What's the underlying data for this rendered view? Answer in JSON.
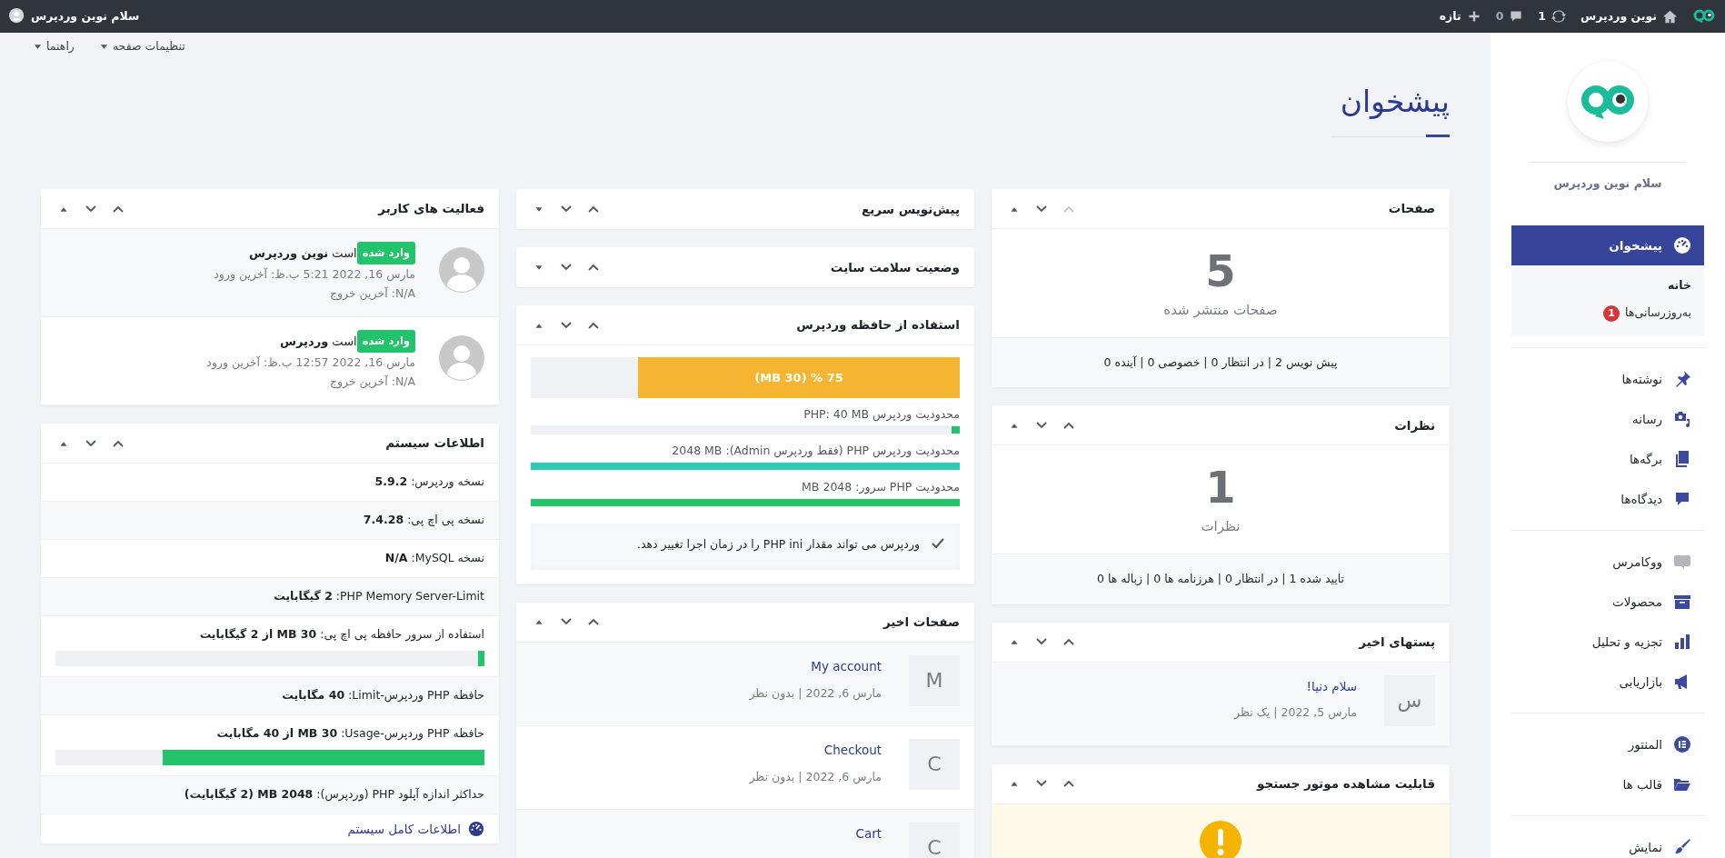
{
  "admin_bar": {
    "site_name": "نوین وردپرس",
    "updates": "1",
    "comments": "0",
    "new_label": "تازه",
    "greeting": "سلام نوین وردپرس"
  },
  "screen_links": [
    {
      "label": "تنظیمات صفحه"
    },
    {
      "label": "راهنما"
    }
  ],
  "page_title": "پیشخوان",
  "sidebar": {
    "greeting": "سلام نوین وردپرس",
    "groups": [
      {
        "items": [
          {
            "label": "پیشخوان",
            "selected": true,
            "children": [
              {
                "label": "خانه",
                "selected": true
              },
              {
                "label": "به‌روزرسانی‌ها",
                "selected": false,
                "badge": "1"
              }
            ]
          }
        ]
      },
      {
        "items": [
          {
            "label": "نوشته‌ها",
            "selected": false
          },
          {
            "label": "رسانه",
            "selected": false
          },
          {
            "label": "برگه‌ها",
            "selected": false
          },
          {
            "label": "دیدگاه‌ها",
            "selected": false
          }
        ]
      },
      {
        "items": [
          {
            "label": "ووکامرس",
            "selected": false
          },
          {
            "label": "محصولات",
            "selected": false
          },
          {
            "label": "تجزیه و تحلیل",
            "selected": false
          },
          {
            "label": "بازاریابی",
            "selected": false
          }
        ]
      },
      {
        "items": [
          {
            "label": "المنتور",
            "selected": false
          },
          {
            "label": "قالب ها",
            "selected": false
          }
        ]
      },
      {
        "items": [
          {
            "label": "نمایش",
            "selected": false
          }
        ]
      }
    ]
  },
  "columns": [
    {
      "cards": [
        {
          "kind": "count",
          "title": "صفحات",
          "expanded": true,
          "move_up_disabled": true,
          "count": "5",
          "caption": "صفحات منتشر شده",
          "summary": "پیش نویس 2 | در انتظار 0 | خصوصی 0 | آینده 0"
        },
        {
          "kind": "count",
          "title": "نظرات",
          "expanded": true,
          "move_up_disabled": false,
          "count": "1",
          "caption": "نظرات",
          "summary": "تایید شده 1 | در انتظار 0 | هرزنامه ها 0 | زباله ها 0"
        },
        {
          "kind": "list",
          "title": "پستهای اخیر",
          "expanded": true,
          "move_up_disabled": false,
          "items": [
            {
              "thumb": "س",
              "title": "سلام دنیا!",
              "meta": "مارس 5, 2022 | یک نظر"
            }
          ]
        },
        {
          "kind": "notice",
          "title": "قابلیت مشاهده موتور جستجو",
          "expanded": true,
          "move_up_disabled": false
        }
      ]
    },
    {
      "cards": [
        {
          "title": "پیش‌نویس سریع",
          "expanded": false,
          "move_up_disabled": false
        },
        {
          "title": "وضعیت سلامت سایت",
          "expanded": false,
          "move_up_disabled": false
        },
        {
          "kind": "memory",
          "title": "استفاده از حافظه وردپرس",
          "expanded": true,
          "move_up_disabled": false,
          "main_bar": {
            "label": "(MB 30) % 75",
            "level": 0.75
          },
          "limits": [
            {
              "label": "محدودیت وردپرس PHP: 40 MB",
              "level": 0.02,
              "color": "#22c36b"
            },
            {
              "label": "محدودیت وردپرس PHP (فقط وردپرس Admin): 2048 MB",
              "level": 1,
              "color": "#2ecbb6"
            },
            {
              "label": "محدودیت PHP سرور: 2048 MB",
              "level": 1,
              "color": "#22c36b"
            }
          ],
          "note": "وردپرس می تواند مقدار PHP ini را در زمان اجرا تغییر دهد."
        },
        {
          "kind": "list",
          "title": "صفحات اخیر",
          "expanded": true,
          "move_up_disabled": false,
          "items": [
            {
              "thumb": "M",
              "title": "My account",
              "meta": "مارس 6, 2022 | بدون نظر"
            },
            {
              "thumb": "C",
              "title": "Checkout",
              "meta": "مارس 6, 2022 | بدون نظر"
            },
            {
              "thumb": "C",
              "title": "Cart"
            }
          ]
        }
      ]
    },
    {
      "cards": [
        {
          "kind": "activity",
          "title": "فعالیت های کاربر",
          "expanded": true,
          "move_up_disabled": false,
          "users": [
            {
              "status": "وارد شده",
              "name": "است **نوین وردپرس**",
              "last_login": "مارس 16, 2022 5:21 ب.ظ: آخرین ورود",
              "last_logout": "N/A: آخرین خروج"
            },
            {
              "status": "وارد شده",
              "name": "است **وردپرس**",
              "last_login": "مارس 16, 2022 12:57 ب.ظ: آخرین ورود",
              "last_logout": "N/A: آخرین خروج"
            }
          ]
        },
        {
          "kind": "sysinfo",
          "title": "اطلاعات سیستم",
          "expanded": true,
          "move_up_disabled": false,
          "rows": [
            {
              "kind": "text",
              "text": "نسخه وردپرس: **5.9.2**"
            },
            {
              "kind": "text",
              "text": "نسخه پی اچ پی: **7.4.28**"
            },
            {
              "kind": "text",
              "text": "نسخه MySQL: **N/A**"
            },
            {
              "kind": "text",
              "text": "PHP Memory Server-Limit: **2 گیگابایت**"
            },
            {
              "kind": "bar",
              "text": "استفاده از سرور حافظه پی اچ پی: **30 MB از 2 گیگابایت**",
              "level": 0.015
            },
            {
              "kind": "text",
              "text": "حافظه PHP وردپرس-Limit: **40 مگابایت**"
            },
            {
              "kind": "bar",
              "text": "حافظه PHP وردپرس-Usage: **30 MB از 40 مگابایت**",
              "level": 0.75
            },
            {
              "kind": "text",
              "text": "حداکثر اندازه آپلود PHP (وردپرس): **2048 MB (2 گیگابایت)**"
            }
          ],
          "link": "اطلاعات کامل سیستم"
        }
      ]
    }
  ]
}
